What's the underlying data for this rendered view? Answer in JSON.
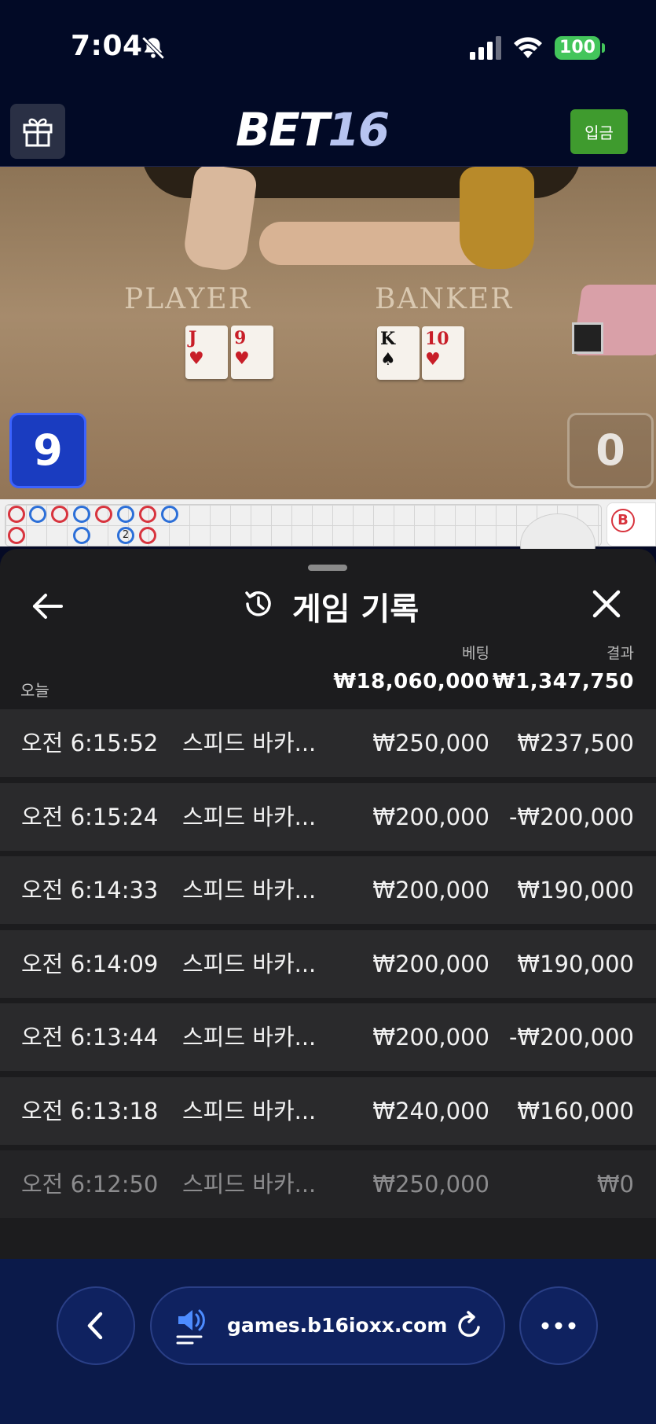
{
  "status_bar": {
    "time": "7:04",
    "battery": "100"
  },
  "header": {
    "logo_part1": "BET",
    "logo_part2": "16",
    "deposit_label": "입금"
  },
  "video": {
    "player_label": "PLAYER",
    "banker_label": "BANKER",
    "player_cards": [
      {
        "rank": "J",
        "suit": "♥",
        "color": "red"
      },
      {
        "rank": "9",
        "suit": "♥",
        "color": "red"
      }
    ],
    "banker_cards": [
      {
        "rank": "K",
        "suit": "♠",
        "color": "black"
      },
      {
        "rank": "10",
        "suit": "♥",
        "color": "red"
      }
    ],
    "player_score": "9",
    "banker_score": "0"
  },
  "roadmap": {
    "side_label": "B",
    "marker": "2"
  },
  "history": {
    "title": "게임 기록",
    "col_bet": "베팅",
    "col_result": "결과",
    "today_label": "오늘",
    "total_bet": "₩18,060,000",
    "total_result": "₩1,347,750",
    "rows": [
      {
        "time": "오전 6:15:52",
        "game": "스피드 바카...",
        "bet": "₩250,000",
        "result": "₩237,500"
      },
      {
        "time": "오전 6:15:24",
        "game": "스피드 바카...",
        "bet": "₩200,000",
        "result": "-₩200,000"
      },
      {
        "time": "오전 6:14:33",
        "game": "스피드 바카...",
        "bet": "₩200,000",
        "result": "₩190,000"
      },
      {
        "time": "오전 6:14:09",
        "game": "스피드 바카...",
        "bet": "₩200,000",
        "result": "₩190,000"
      },
      {
        "time": "오전 6:13:44",
        "game": "스피드 바카...",
        "bet": "₩200,000",
        "result": "-₩200,000"
      },
      {
        "time": "오전 6:13:18",
        "game": "스피드 바카...",
        "bet": "₩240,000",
        "result": "₩160,000"
      },
      {
        "time": "오전 6:12:50",
        "game": "스피드 바카...",
        "bet": "₩250,000",
        "result": "₩0"
      }
    ]
  },
  "browser": {
    "url": "games.b16ioxx.com"
  },
  "colors": {
    "deposit": "#3f9b2e",
    "player_score": "#1a3cc0",
    "sheet_bg": "#1c1c1e",
    "row_bg": "#2a2a2c",
    "browser_bg": "#0b1a4a"
  }
}
